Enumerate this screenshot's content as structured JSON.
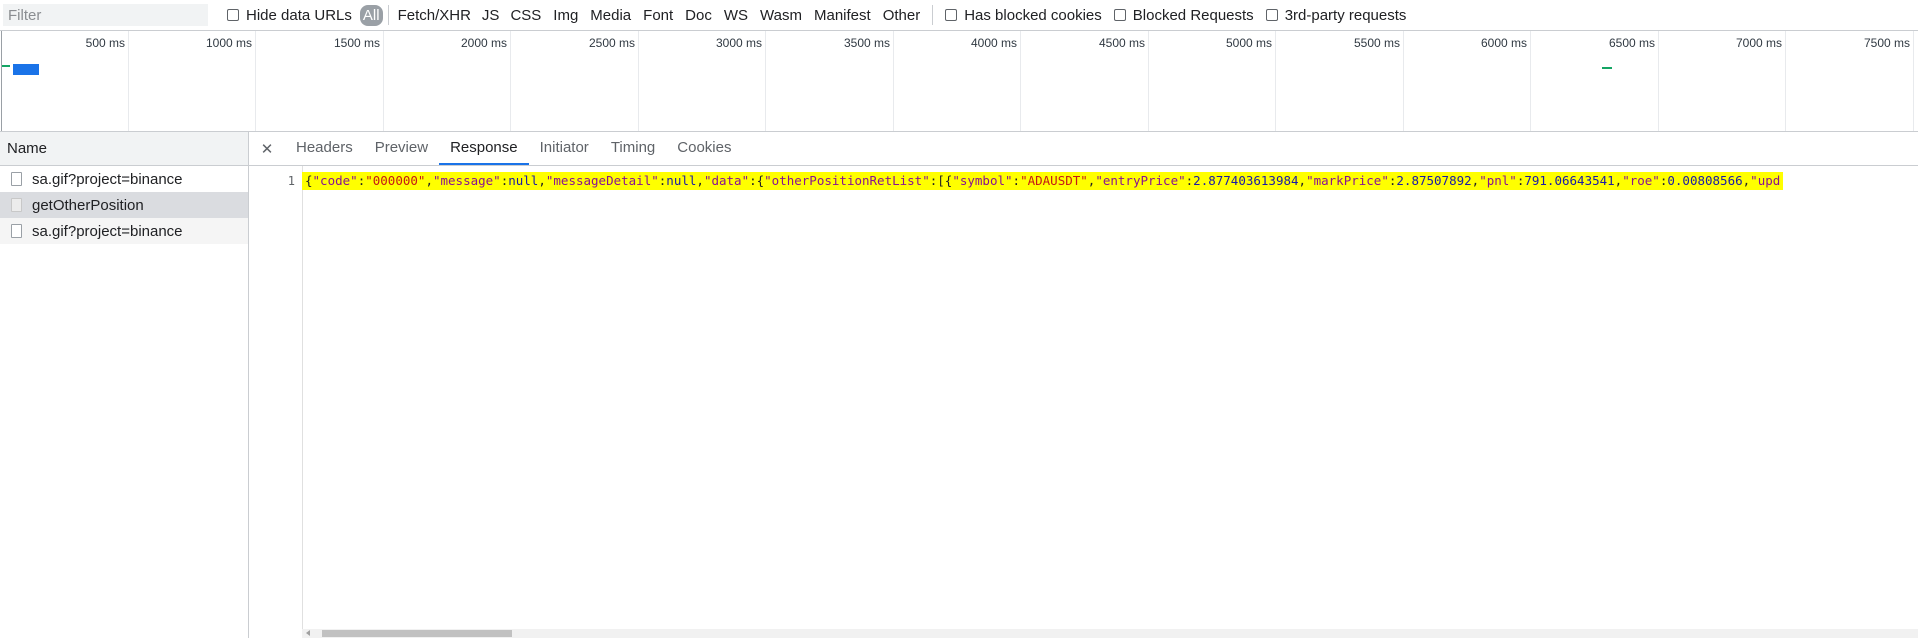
{
  "filter_bar": {
    "placeholder": "Filter",
    "hide_data_urls": "Hide data URLs",
    "types": [
      "All",
      "Fetch/XHR",
      "JS",
      "CSS",
      "Img",
      "Media",
      "Font",
      "Doc",
      "WS",
      "Wasm",
      "Manifest",
      "Other"
    ],
    "active_type": "All",
    "has_blocked_cookies": "Has blocked cookies",
    "blocked_requests": "Blocked Requests",
    "third_party": "3rd-party requests"
  },
  "overview": {
    "ticks": [
      "500 ms",
      "1000 ms",
      "1500 ms",
      "2000 ms",
      "2500 ms",
      "3000 ms",
      "3500 ms",
      "4000 ms",
      "4500 ms",
      "5000 ms",
      "5500 ms",
      "6000 ms",
      "6500 ms",
      "7000 ms",
      "7500 ms"
    ],
    "bar_color": "#14a564"
  },
  "request_list": {
    "header": "Name",
    "rows": [
      {
        "name": "sa.gif?project=binance"
      },
      {
        "name": "getOtherPosition"
      },
      {
        "name": "sa.gif?project=binance"
      }
    ],
    "selected_index": 1
  },
  "details": {
    "close_icon": "close-icon",
    "tabs": [
      "Headers",
      "Preview",
      "Response",
      "Initiator",
      "Timing",
      "Cookies"
    ],
    "active_tab": "Response",
    "line_number": "1",
    "response_tokens": [
      {
        "t": "{",
        "c": "p"
      },
      {
        "t": "\"code\"",
        "c": "k"
      },
      {
        "t": ":",
        "c": "p"
      },
      {
        "t": "\"000000\"",
        "c": "s"
      },
      {
        "t": ",",
        "c": "p"
      },
      {
        "t": "\"message\"",
        "c": "k"
      },
      {
        "t": ":",
        "c": "p"
      },
      {
        "t": "null",
        "c": "n"
      },
      {
        "t": ",",
        "c": "p"
      },
      {
        "t": "\"messageDetail\"",
        "c": "k"
      },
      {
        "t": ":",
        "c": "p"
      },
      {
        "t": "null",
        "c": "n"
      },
      {
        "t": ",",
        "c": "p"
      },
      {
        "t": "\"data\"",
        "c": "k"
      },
      {
        "t": ":{",
        "c": "p"
      },
      {
        "t": "\"otherPositionRetList\"",
        "c": "k"
      },
      {
        "t": ":[{",
        "c": "p"
      },
      {
        "t": "\"symbol\"",
        "c": "k"
      },
      {
        "t": ":",
        "c": "p"
      },
      {
        "t": "\"ADAUSDT\"",
        "c": "s"
      },
      {
        "t": ",",
        "c": "p"
      },
      {
        "t": "\"entryPrice\"",
        "c": "k"
      },
      {
        "t": ":",
        "c": "p"
      },
      {
        "t": "2.877403613984",
        "c": "n"
      },
      {
        "t": ",",
        "c": "p"
      },
      {
        "t": "\"markPrice\"",
        "c": "k"
      },
      {
        "t": ":",
        "c": "p"
      },
      {
        "t": "2.87507892",
        "c": "n"
      },
      {
        "t": ",",
        "c": "p"
      },
      {
        "t": "\"pnl\"",
        "c": "k"
      },
      {
        "t": ":",
        "c": "p"
      },
      {
        "t": "791.06643541",
        "c": "n"
      },
      {
        "t": ",",
        "c": "p"
      },
      {
        "t": "\"roe\"",
        "c": "k"
      },
      {
        "t": ":",
        "c": "p"
      },
      {
        "t": "0.00808566",
        "c": "n"
      },
      {
        "t": ",",
        "c": "p"
      },
      {
        "t": "\"upd",
        "c": "k"
      }
    ]
  }
}
